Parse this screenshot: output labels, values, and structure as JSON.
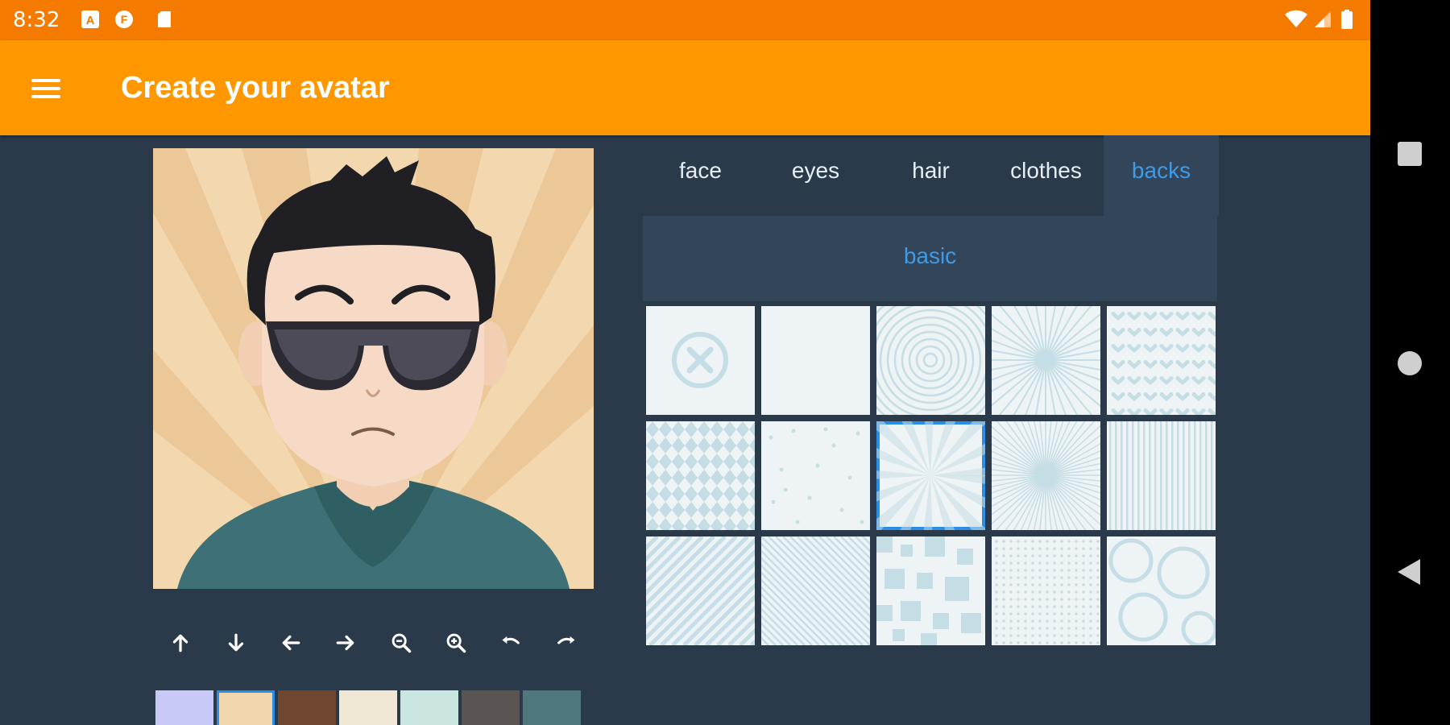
{
  "status_bar": {
    "time": "8:32",
    "left_icons": [
      "a-icon",
      "notification-icon",
      "sd-card-icon"
    ],
    "right_icons": [
      "wifi-icon",
      "signal-icon",
      "battery-icon"
    ]
  },
  "app_bar": {
    "menu_icon": "menu-icon",
    "title": "Create your avatar",
    "color": "#ff9800"
  },
  "preview": {
    "controls": [
      {
        "name": "move-up-button",
        "icon": "arrow-up-icon"
      },
      {
        "name": "move-down-button",
        "icon": "arrow-down-icon"
      },
      {
        "name": "move-left-button",
        "icon": "arrow-left-icon"
      },
      {
        "name": "move-right-button",
        "icon": "arrow-right-icon"
      },
      {
        "name": "zoom-out-button",
        "icon": "zoom-out-icon"
      },
      {
        "name": "zoom-in-button",
        "icon": "zoom-in-icon"
      },
      {
        "name": "undo-button",
        "icon": "undo-icon"
      },
      {
        "name": "redo-button",
        "icon": "redo-icon"
      }
    ],
    "swatches": [
      "#c8c9f6",
      "#f1d7ad",
      "#6f4630",
      "#f0e8d5",
      "#c9e6e0",
      "#5a5552",
      "#4f777c"
    ],
    "selected_swatch": 1
  },
  "tabs": [
    "face",
    "eyes",
    "hair",
    "clothes",
    "backs"
  ],
  "active_tab": "backs",
  "subtabs": [
    "basic"
  ],
  "accent_color": "#3d9be9",
  "backgrounds": {
    "tiles": [
      "none",
      "plain",
      "circles",
      "sunburst",
      "hearts",
      "diamonds",
      "dots",
      "rays",
      "starburst",
      "stripes-vertical",
      "stripes-diagonal",
      "stripes-diagonal-thin",
      "pixels",
      "grid-dots",
      "swirls"
    ],
    "selected": 7
  },
  "nav_bar": [
    "recents-icon",
    "home-icon",
    "back-icon"
  ]
}
